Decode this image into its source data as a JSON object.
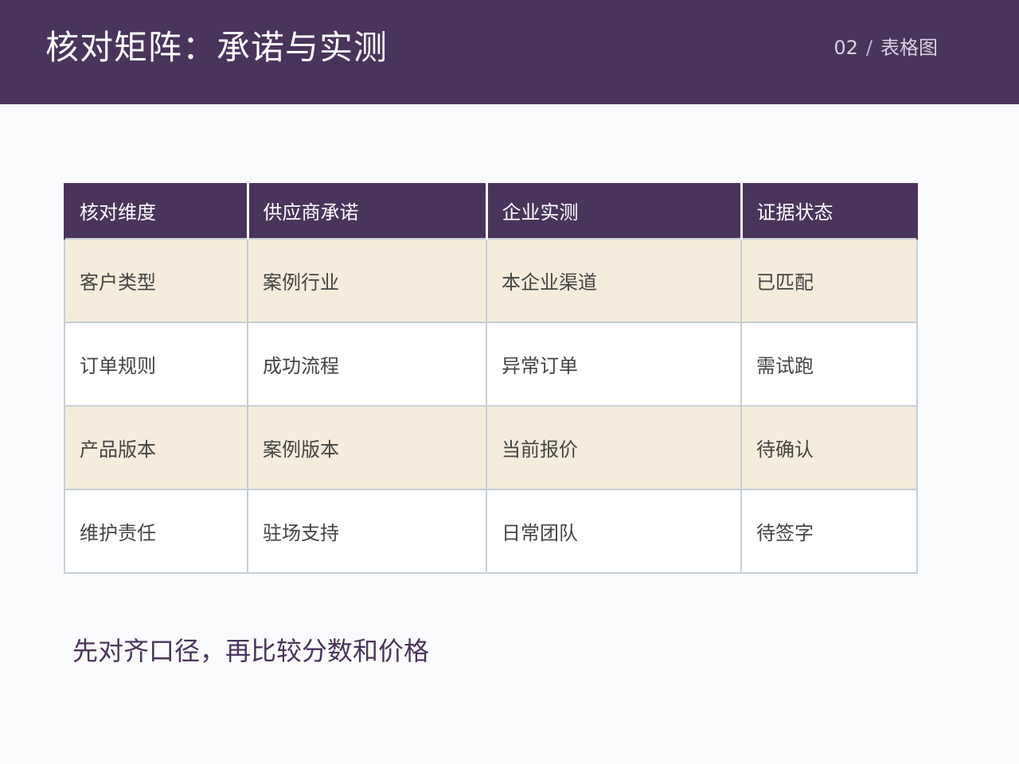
{
  "header": {
    "title": "核对矩阵：承诺与实测",
    "page_number": "02",
    "separator": "/",
    "section": "表格图"
  },
  "table": {
    "columns": [
      "核对维度",
      "供应商承诺",
      "企业实测",
      "证据状态"
    ],
    "rows": [
      [
        "客户类型",
        "案例行业",
        "本企业渠道",
        "已匹配"
      ],
      [
        "订单规则",
        "成功流程",
        "异常订单",
        "需试跑"
      ],
      [
        "产品版本",
        "案例版本",
        "当前报价",
        "待确认"
      ],
      [
        "维护责任",
        "驻场支持",
        "日常团队",
        "待签字"
      ]
    ]
  },
  "footer": {
    "note": "先对齐口径，再比较分数和价格"
  },
  "colors": {
    "header_bg": "#4A345B",
    "row_shaded_bg": "#F5ECDB",
    "row_plain_bg": "#FFFFFF",
    "grid_border": "#C6CED8",
    "page_bg": "#FAFBFD"
  }
}
